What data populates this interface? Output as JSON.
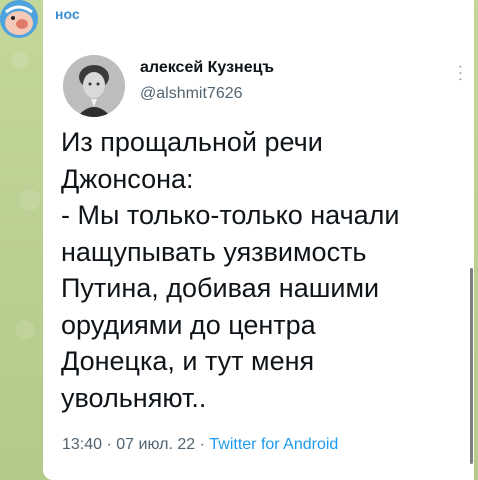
{
  "channel": {
    "avatar_icon": "channel-avatar-icon",
    "sender_name": "нос"
  },
  "tweet": {
    "author_name": "алексей Кузнецъ",
    "author_handle": "@alshmit7626",
    "more_icon": "more-options-icon",
    "text": "Из прощальной речи\nДжонсона:\n- Мы только-только начали\nнащупывать уязвимость\nПутина, добивая нашими\nорудиями до центра\nДонецка, и тут меня\nувольняют..",
    "time": "13:40",
    "date": "07 июл. 22",
    "separator": "·",
    "source": "Twitter for Android"
  },
  "colors": {
    "sender": "#3a8fd4",
    "link": "#1d9bf0",
    "chat_background": "#b9cf93"
  }
}
